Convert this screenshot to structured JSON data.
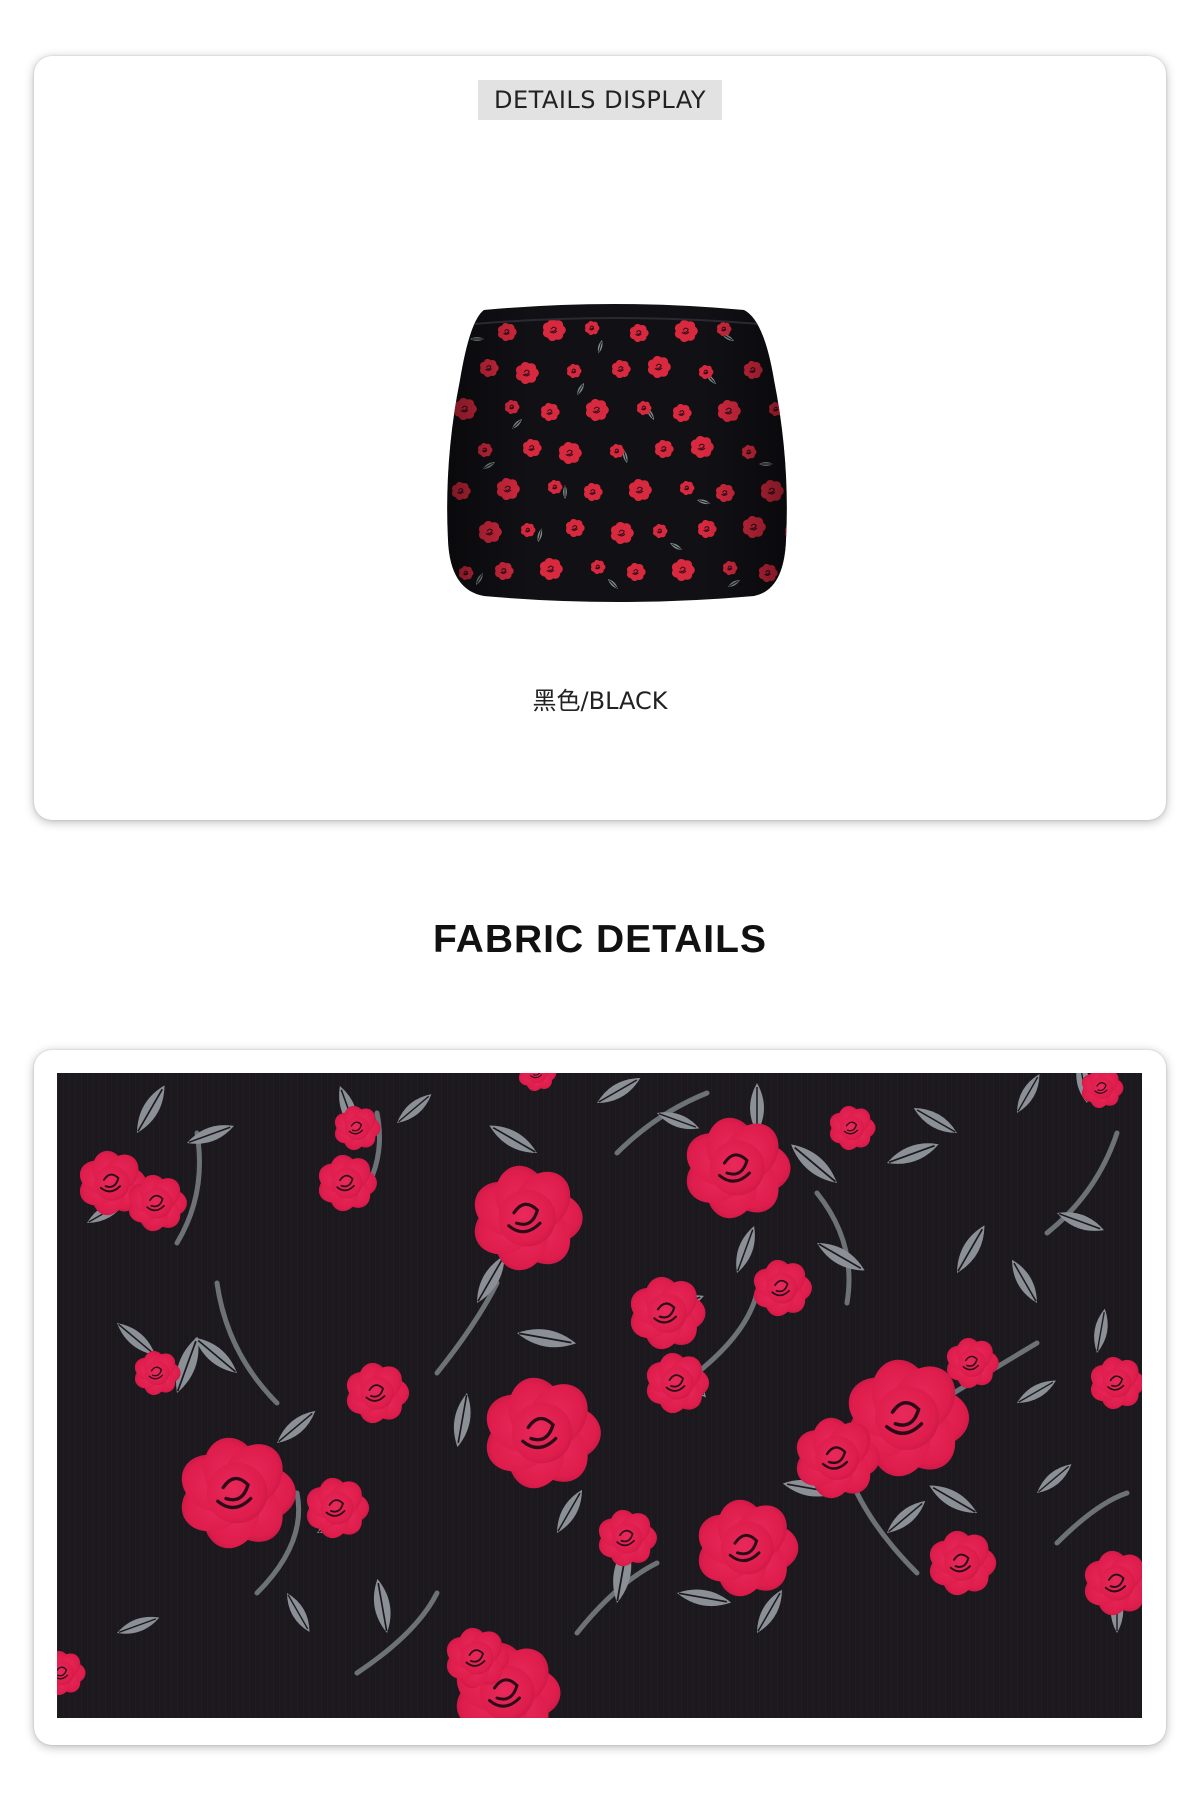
{
  "details": {
    "badge": "DETAILS DISPLAY",
    "color_label": "黑色/BLACK"
  },
  "fabric": {
    "heading": "FABRIC DETAILS"
  },
  "colors": {
    "fabric_base": "#19161c",
    "rose": "#e0204f",
    "leaf": "#8a9096"
  }
}
